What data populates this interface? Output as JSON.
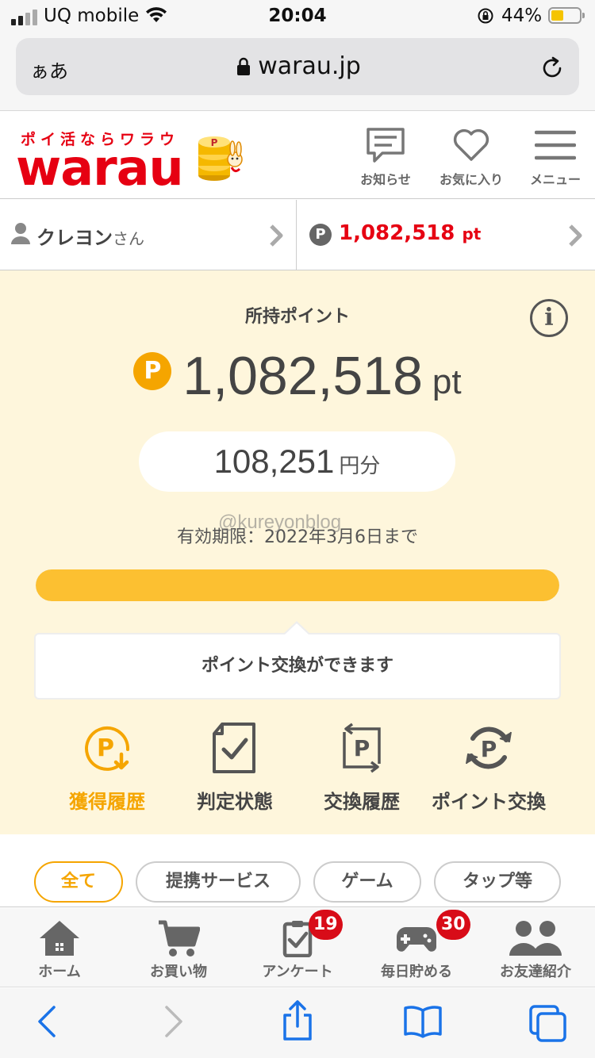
{
  "status_bar": {
    "carrier": "UQ mobile",
    "time": "20:04",
    "battery_pct": "44%",
    "battery_level": 0.44
  },
  "address_bar": {
    "aa_label": "ぁあ",
    "url": "warau.jp"
  },
  "header": {
    "tagline": "ポイ活ならワラウ",
    "logo_text": "warau",
    "nav": [
      {
        "label": "お知らせ",
        "icon": "notice-icon"
      },
      {
        "label": "お気に入り",
        "icon": "heart-icon"
      },
      {
        "label": "メニュー",
        "icon": "hamburger-icon"
      }
    ]
  },
  "user": {
    "name": "クレヨン",
    "honorific": "さん",
    "points": "1,082,518",
    "points_unit": "pt",
    "point_badge": "P"
  },
  "points_panel": {
    "title": "所持ポイント",
    "coin": "P",
    "amount": "1,082,518",
    "unit": "pt",
    "yen_value": "108,251",
    "yen_unit": "円分",
    "expiry": "有効期限：2022年3月6日まで",
    "watermark": "@kureyonblog",
    "progress_fraction": 1.0,
    "exchange_message": "ポイント交換ができます",
    "actions": [
      {
        "label": "獲得履歴",
        "icon": "earn-history-icon",
        "active": true
      },
      {
        "label": "判定状態",
        "icon": "judgement-icon",
        "active": false
      },
      {
        "label": "交換履歴",
        "icon": "exchange-history-icon",
        "active": false
      },
      {
        "label": "ポイント交換",
        "icon": "point-exchange-icon",
        "active": false
      }
    ]
  },
  "filters": [
    {
      "label": "全て",
      "active": true
    },
    {
      "label": "提携サービス",
      "active": false
    },
    {
      "label": "ゲーム",
      "active": false
    },
    {
      "label": "タップ等",
      "active": false
    }
  ],
  "bottom_nav": [
    {
      "label": "ホーム",
      "icon": "home-icon",
      "badge": ""
    },
    {
      "label": "お買い物",
      "icon": "cart-icon",
      "badge": ""
    },
    {
      "label": "アンケート",
      "icon": "survey-icon",
      "badge": "19"
    },
    {
      "label": "毎日貯める",
      "icon": "gamepad-icon",
      "badge": "30"
    },
    {
      "label": "お友達紹介",
      "icon": "friends-icon",
      "badge": ""
    }
  ],
  "colors": {
    "brand_red": "#e60012",
    "accent_orange": "#f5a500",
    "panel_bg": "#fef6dc",
    "bar_fill": "#fcc031",
    "badge_red": "#d80c18",
    "ios_blue": "#1a73e8"
  }
}
